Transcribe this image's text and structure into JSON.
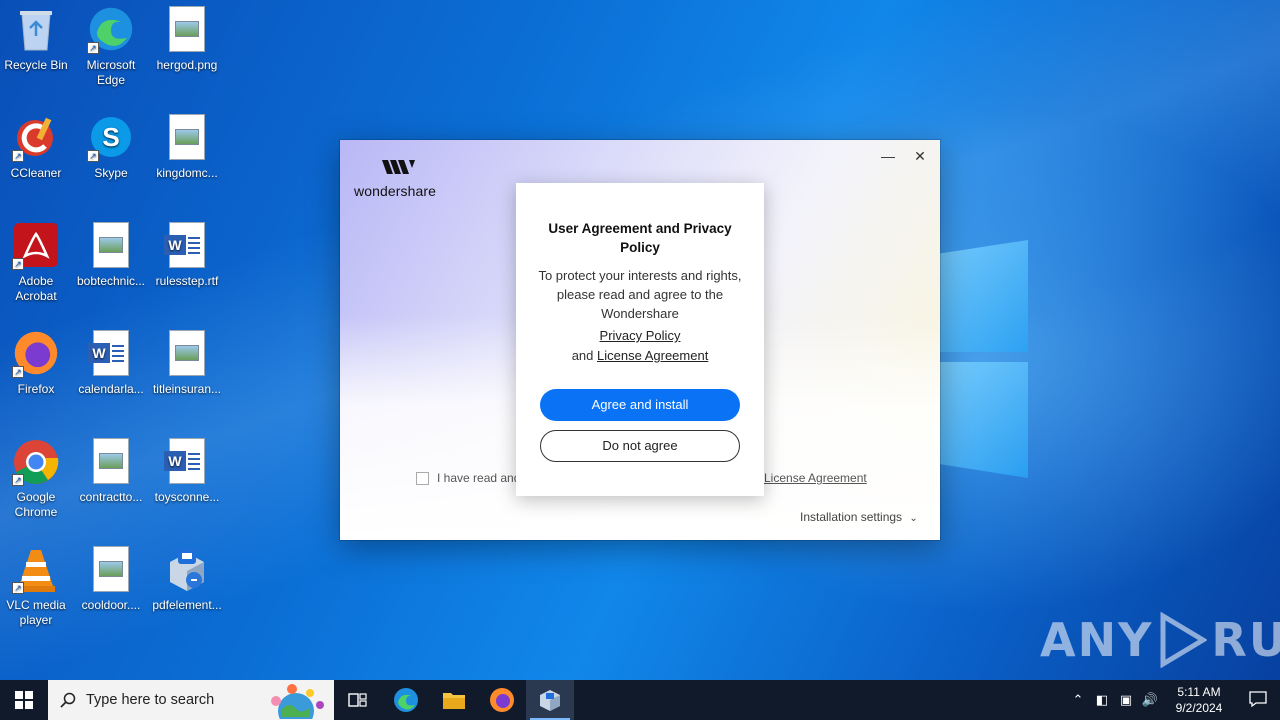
{
  "desktop": {
    "icons": [
      {
        "label": "Recycle Bin",
        "icon": "recycle-bin-icon"
      },
      {
        "label": "Microsoft Edge",
        "icon": "edge-icon"
      },
      {
        "label": "hergod.png",
        "icon": "image-file-icon"
      },
      {
        "label": "CCleaner",
        "icon": "ccleaner-icon"
      },
      {
        "label": "Skype",
        "icon": "skype-icon"
      },
      {
        "label": "kingdomc...",
        "icon": "image-file-icon"
      },
      {
        "label": "Adobe Acrobat",
        "icon": "acrobat-icon"
      },
      {
        "label": "bobtechnic...",
        "icon": "image-file-icon"
      },
      {
        "label": "rulesstep.rtf",
        "icon": "word-file-icon"
      },
      {
        "label": "Firefox",
        "icon": "firefox-icon"
      },
      {
        "label": "calendarla...",
        "icon": "word-file-icon"
      },
      {
        "label": "titleinsuran...",
        "icon": "image-file-icon"
      },
      {
        "label": "Google Chrome",
        "icon": "chrome-icon"
      },
      {
        "label": "contractto...",
        "icon": "image-file-icon"
      },
      {
        "label": "toysconne...",
        "icon": "word-file-icon"
      },
      {
        "label": "VLC media player",
        "icon": "vlc-icon"
      },
      {
        "label": "cooldoor....",
        "icon": "image-file-icon"
      },
      {
        "label": "pdfelement...",
        "icon": "pdfelement-installer-icon"
      }
    ]
  },
  "installer": {
    "brand": "wondershare",
    "checkbox_text": "I have read and",
    "license_link": "License Agreement",
    "installation_settings": "Installation settings",
    "minimize_glyph": "—",
    "close_glyph": "✕"
  },
  "modal": {
    "title": "User Agreement and Privacy Policy",
    "description": "To protect your interests and rights, please read and agree to the Wondershare",
    "privacy_link": "Privacy Policy",
    "and_text": "and",
    "license_link": "License Agreement",
    "agree_button": "Agree and install",
    "disagree_button": "Do not agree"
  },
  "watermark": {
    "left": "ANY",
    "right": "RUN"
  },
  "taskbar": {
    "search_placeholder": "Type here to search",
    "pinned": [
      "task-view-icon",
      "edge-icon",
      "file-explorer-icon",
      "firefox-icon",
      "installer-icon"
    ],
    "active_index": 4
  },
  "tray": {
    "time": "5:11 AM",
    "date": "9/2/2024"
  },
  "colors": {
    "accent_button": "#0a72f5",
    "taskbar_bg": "#101a2a"
  }
}
